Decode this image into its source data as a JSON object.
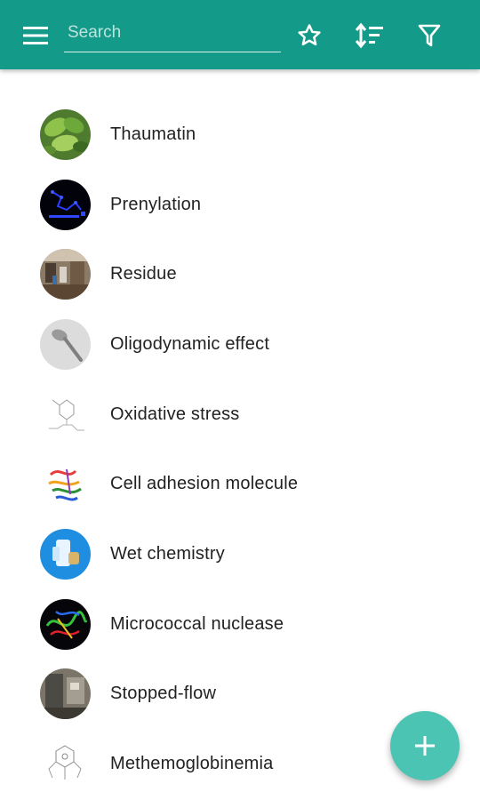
{
  "search": {
    "placeholder": "Search"
  },
  "toolbar": {
    "menu_icon": "menu-icon",
    "favorite_icon": "star-outline-icon",
    "sort_icon": "sort-icon",
    "filter_icon": "filter-icon"
  },
  "colors": {
    "appbar": "#139a88",
    "fab": "#4cc4b3",
    "text": "#222222"
  },
  "items": [
    {
      "label": "Thaumatin",
      "thumbnail": "leaves-photo"
    },
    {
      "label": "Prenylation",
      "thumbnail": "molecule-diagram-dark"
    },
    {
      "label": "Residue",
      "thumbnail": "lab-photo"
    },
    {
      "label": "Oligodynamic effect",
      "thumbnail": "spoon-photo"
    },
    {
      "label": "Oxidative stress",
      "thumbnail": "chemical-structure"
    },
    {
      "label": "Cell adhesion molecule",
      "thumbnail": "protein-ribbon"
    },
    {
      "label": "Wet chemistry",
      "thumbnail": "chemistry-icon"
    },
    {
      "label": "Micrococcal nuclease",
      "thumbnail": "protein-structure-dark"
    },
    {
      "label": "Stopped-flow",
      "thumbnail": "instrument-photo"
    },
    {
      "label": "Methemoglobinemia",
      "thumbnail": "chemical-structure"
    }
  ],
  "fab": {
    "icon": "plus-icon"
  }
}
